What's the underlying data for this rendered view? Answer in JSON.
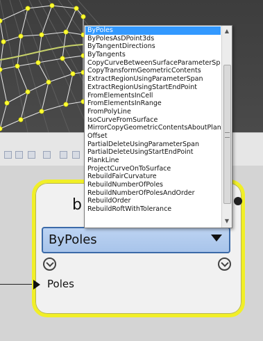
{
  "node": {
    "title_fragment": "b",
    "selected_method": "ByPoles",
    "input_port_label": "Poles"
  },
  "method_list": {
    "items": [
      "ByPoles",
      "ByPolesAsDPoint3ds",
      "ByTangentDirections",
      "ByTangents",
      "CopyCurveBetweenSurfaceParameterSpaces",
      "CopyTransformGeometricContents",
      "ExtractRegionUsingParameterSpan",
      "ExtractRegionUsingStartEndPoint",
      "FromElementsInCell",
      "FromElementsInRange",
      "FromPolyLine",
      "IsoCurveFromSurface",
      "MirrorCopyGeometricContentsAboutPlane",
      "Offset",
      "PartialDeleteUsingParameterSpan",
      "PartialDeleteUsingStartEndPoint",
      "PlankLine",
      "ProjectCurveOnToSurface",
      "RebuildFairCurvature",
      "RebuildNumberOfPoles",
      "RebuildNumberOfPolesAndOrder",
      "RebuildOrder",
      "RebuildRoftWithTolerance"
    ],
    "selected_index": 0
  },
  "scrollbar": {
    "up_glyph": "▲",
    "down_glyph": "▼"
  },
  "colors": {
    "node_highlight": "#f1ef27",
    "selection": "#3399ff",
    "dropdown": "#bcd3f2",
    "control_point": "#ffff33"
  },
  "icons": [
    "chevron-down-icon",
    "chevron-down-icon",
    "triangle-port-icon",
    "dropdown-arrow-icon"
  ]
}
